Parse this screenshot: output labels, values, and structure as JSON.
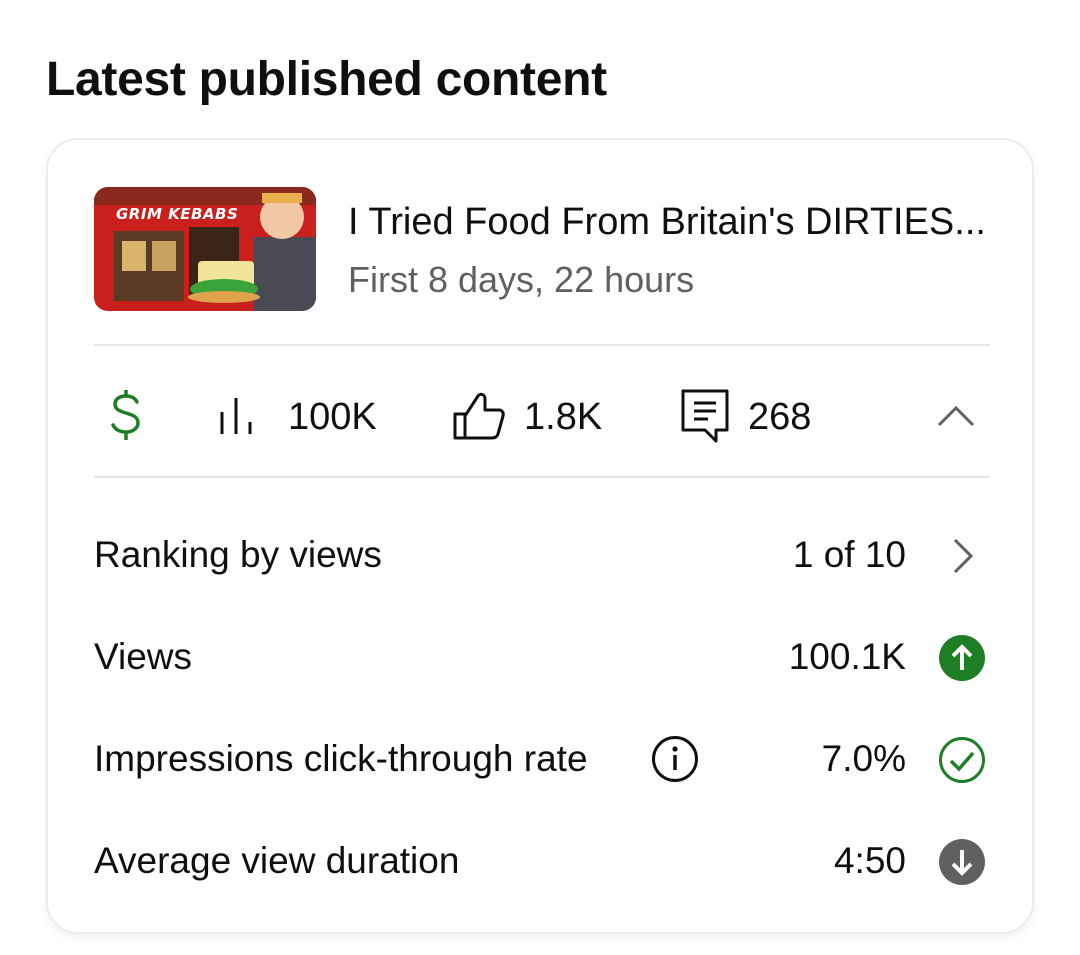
{
  "section_title": "Latest published content",
  "video": {
    "thumbnail_text": "GRIM KEBABS",
    "title": "I Tried Food From Britain's DIRTIES...",
    "period": "First 8 days, 22 hours"
  },
  "stats": {
    "revenue_icon": "dollar-icon",
    "views_icon": "bar-chart-icon",
    "views": "100K",
    "likes_icon": "thumbs-up-icon",
    "likes": "1.8K",
    "comments_icon": "comment-icon",
    "comments": "268",
    "collapse_icon": "chevron-up-icon"
  },
  "metrics": [
    {
      "label": "Ranking by views",
      "value": "1 of 10",
      "icon": "chevron-right-icon"
    },
    {
      "label": "Views",
      "value": "100.1K",
      "icon": "arrow-up-circle-icon"
    },
    {
      "label": "Impressions click-through rate",
      "value": "7.0%",
      "icon": "check-circle-icon",
      "info_icon": "info-icon"
    },
    {
      "label": "Average view duration",
      "value": "4:50",
      "icon": "arrow-down-circle-icon"
    }
  ],
  "colors": {
    "green": "#1e7e26",
    "gray_badge": "#606060",
    "text": "#0f0f0f",
    "subtext": "#606060"
  }
}
